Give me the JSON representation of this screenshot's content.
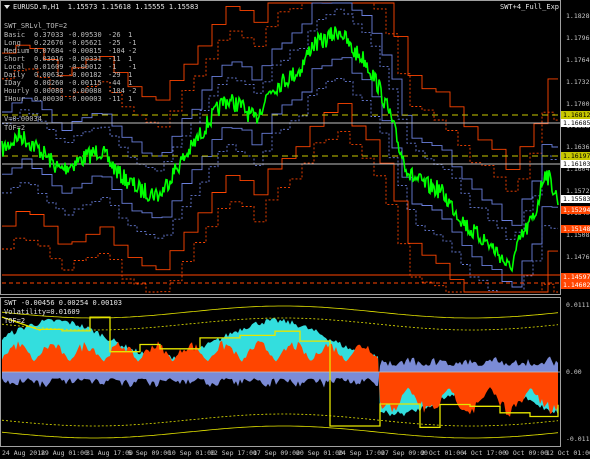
{
  "header": {
    "symbol_line": "EURUSD.m,H1  1.15573 1.15618 1.15555 1.15583",
    "indicator_name": "SWT+4_Full_Exp",
    "menu_icon": "triangle-down-icon"
  },
  "stats": {
    "title": "SWT_SRLvl_TOF=2",
    "rows": [
      {
        "label": "Basic",
        "a": "0.37033",
        "b": "-0.09530",
        "c": "-26",
        "d": "1"
      },
      {
        "label": "Long",
        "a": "0.22676",
        "b": "-0.05621",
        "c": "-25",
        "d": "-1"
      },
      {
        "label": "Medium",
        "a": "0.07684",
        "b": "-0.00815",
        "c": "-104",
        "d": "-2"
      },
      {
        "label": "Short",
        "a": "0.03016",
        "b": "-0.00331",
        "c": "-11",
        "d": "1"
      },
      {
        "label": "Local",
        "a": "0.01609",
        "b": "-0.00012",
        "c": "-1",
        "d": "-1"
      },
      {
        "label": "Daily",
        "a": "0.00632",
        "b": "-0.00182",
        "c": "-29",
        "d": "1"
      },
      {
        "label": "IDay",
        "a": "0.00260",
        "b": "-0.00115",
        "c": "-44",
        "d": "1"
      },
      {
        "label": "Hourly",
        "a": "0.00080",
        "b": "-0.00088",
        "c": "-104",
        "d": "-2"
      },
      {
        "label": "IHour",
        "a": "0.00030",
        "b": "-0.00003",
        "c": "-11",
        "d": "1"
      }
    ],
    "v_line": "V=0.00034",
    "tof_line": "TOF=2"
  },
  "price_scale": {
    "labels": [
      "1.18280",
      "1.17960",
      "1.17640",
      "1.17325",
      "1.17005",
      "1.16685",
      "1.16365",
      "1.16045",
      "1.15725",
      "1.15405",
      "1.15085",
      "1.14760",
      "1.14440"
    ],
    "boxes": [
      {
        "value": "1.16812",
        "bg": "#c8c800",
        "fg": "#000000"
      },
      {
        "value": "1.16685",
        "bg": "#ffffff",
        "fg": "#000000"
      },
      {
        "value": "1.16197",
        "bg": "#c8c800",
        "fg": "#000000"
      },
      {
        "value": "1.16103",
        "bg": "#ffffff",
        "fg": "#000000"
      },
      {
        "value": "1.15583",
        "bg": "#ffffff",
        "fg": "#000000"
      },
      {
        "value": "1.15294",
        "bg": "#ff4500",
        "fg": "#ffffff"
      },
      {
        "value": "1.15148",
        "bg": "#ff4500",
        "fg": "#ffffff"
      },
      {
        "value": "1.14597",
        "bg": "#ff4500",
        "fg": "#ffffff"
      },
      {
        "value": "1.14602",
        "bg": "#ff4500",
        "fg": "#ffffff"
      }
    ]
  },
  "sub_window": {
    "title_line": "SWT -0.00456 0.00254 0.00103",
    "volatility": "Volatility=0.01609",
    "tof": "TOF=2",
    "scale": {
      "top": "0.01112",
      "zero": "0.00",
      "bottom": "-0.01112"
    }
  },
  "time_axis": {
    "labels": [
      "24 Aug 2018",
      "29 Aug 01:00",
      "31 Aug 17:00",
      "5 Sep 09:00",
      "10 Sep 01:00",
      "12 Sep 17:00",
      "17 Sep 09:00",
      "20 Sep 01:00",
      "24 Sep 17:00",
      "27 Sep 09:00",
      "2 Oct 01:00",
      "4 Oct 17:00",
      "9 Oct 09:00",
      "12 Oct 01:00"
    ]
  },
  "colors": {
    "background": "#000000",
    "price_line": "#00ff00",
    "support_orange": "#ff4500",
    "level_blue": "#6a7fdc",
    "level_grey": "#c0c0c0",
    "level_yellow": "#c8c800",
    "hist_orange": "#ff4500",
    "hist_cyan": "#33dede",
    "hist_blue": "#7b8bd6",
    "step_yellow": "#e6e600"
  }
}
